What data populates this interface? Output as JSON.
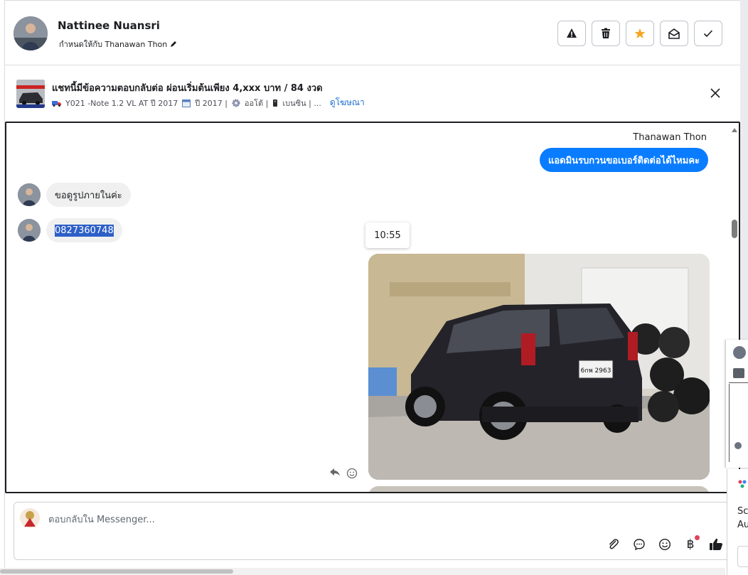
{
  "header": {
    "contact_name": "Nattinee Nuansri",
    "assigned_to": "กำหนดให้กับ Thanawan Thon",
    "actions": [
      "report",
      "delete",
      "star",
      "mark-unread",
      "done"
    ]
  },
  "listing": {
    "title": "แชทนี้มีข้อความตอบกลับต่อ ผ่อนเริ่มต้นเพียง 4,xxx บาท / 84 งวด",
    "model": "Y021 -Note 1.2 VL AT ปี 2017",
    "year": "ปี 2017 |",
    "gear": "ออโต้ |",
    "fuel": "เบนซิน | ...",
    "view_ad": "ดูโฆษณา"
  },
  "chat": {
    "outgoing_sender": "Thanawan Thon",
    "outgoing_message": "แอดมินรบกวนขอเบอร์ติดต่อได้ไหมคะ",
    "incoming": [
      {
        "text": "ขอดูรูปภายในค่ะ"
      },
      {
        "text": "0827360748"
      }
    ],
    "timestamp": "10:55",
    "photo_plate": "6กพ 2963"
  },
  "composer": {
    "placeholder": "ตอบกลับใน Messenger...",
    "baht_symbol": "฿"
  },
  "side_window": {
    "text_line1": "Scr",
    "text_line2": "Au"
  },
  "colors": {
    "accent": "#0a7cff",
    "star": "#f5a623",
    "link": "#1a6fd1"
  }
}
